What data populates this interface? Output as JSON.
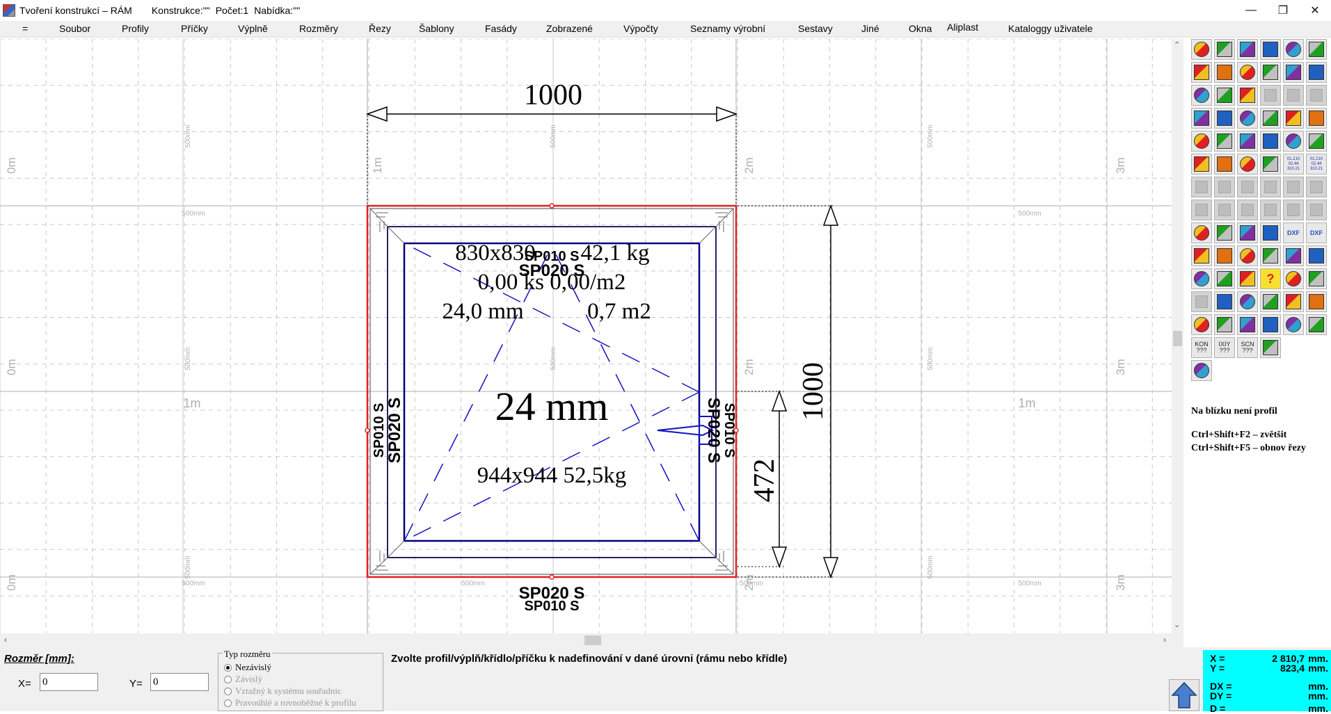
{
  "window": {
    "title": "Tvoření konstrukcí – RÁM",
    "construction": "Konstrukce:\"\"",
    "count": "Počet:1",
    "offer": "Nabídka:\"\"",
    "btn_min": "—",
    "btn_max": "❐",
    "btn_close": "✕"
  },
  "menu": [
    "=",
    "Soubor",
    "Profily",
    "Příčky",
    "Výplně",
    "Rozměry",
    "Řezy",
    "Šablony",
    "Fasády",
    "Zobrazené",
    "Výpočty",
    "Seznamy výrobní",
    "Sestavy",
    "Jiné",
    "Okna",
    "Aliplast",
    "Kataloggy uživatele"
  ],
  "drawing": {
    "top_dim": "1000",
    "right_dim": "1000",
    "handle_dim": "472",
    "outer_profile_top": "SP010 S",
    "inner_profile_top": "SP020 S",
    "outer_profile_bottom": "SP010 S",
    "inner_profile_bottom": "SP020 S",
    "outer_profile_left": "SP010 S",
    "inner_profile_left": "SP020 S",
    "outer_profile_right": "SP010 S",
    "inner_profile_right": "SP020 S",
    "glass_size": "830x830",
    "glass_weight": "42,1 kg",
    "pieces": "0,00 ks 0,00/m2",
    "thickness": "24,0 mm",
    "area": "0,7 m2",
    "fill_label": "24 mm",
    "sash_info": "944x944 52,5kg",
    "grid_m": [
      "0m",
      "1m",
      "2m",
      "3m"
    ],
    "grid_500": "500mm",
    "grid_1m": "1m"
  },
  "toolbar": {
    "count": 85,
    "text_buttons": {
      "KON": "KON\n???",
      "IXIY": "IXIY\n???",
      "SCN": "SCN\n???",
      "DXF": "DXF",
      "code": "01.210\n02.44\n310.21",
      "q": "?"
    }
  },
  "side_info": {
    "near": "Na blízku není profil",
    "shortcut1": "Ctrl+Shift+F2 – zvětšit",
    "shortcut2": "Ctrl+Shift+F5 – obnov řezy"
  },
  "bottom": {
    "dim_label": "Rozměr [mm]:",
    "x_label": "X=",
    "x_value": "0",
    "y_label": "Y=",
    "y_value": "0",
    "type_legend": "Typ rozměru",
    "options": [
      {
        "label": "Nezávislý",
        "selected": true,
        "enabled": true
      },
      {
        "label": "Závislý",
        "selected": false,
        "enabled": false
      },
      {
        "label": "Vztažný k systému souřadnic",
        "selected": false,
        "enabled": false
      },
      {
        "label": "Pravoúhlé a rovnoběžné k profilu",
        "selected": false,
        "enabled": false
      }
    ],
    "status": "Zvolte profil/výplň/křídlo/příčku k nadefinování v dané úrovni (rámu nebo křídle)"
  },
  "coords": {
    "x_label": "X =",
    "x_value": "2 810,7",
    "x_unit": "mm.",
    "y_label": "Y =",
    "y_value": "823,4",
    "y_unit": "mm.",
    "dx_label": "DX =",
    "dx_value": "",
    "dx_unit": "mm.",
    "dy_label": "DY =",
    "dy_value": "",
    "dy_unit": "mm.",
    "d_label": "D =",
    "d_value": "",
    "d_unit": "mm."
  },
  "colors": {
    "frame_red": "#e02020",
    "sash_navy": "#000080",
    "glass_blue": "#1010c0",
    "coords_cyan": "#00ffff",
    "grid": "#c8c8c8"
  }
}
